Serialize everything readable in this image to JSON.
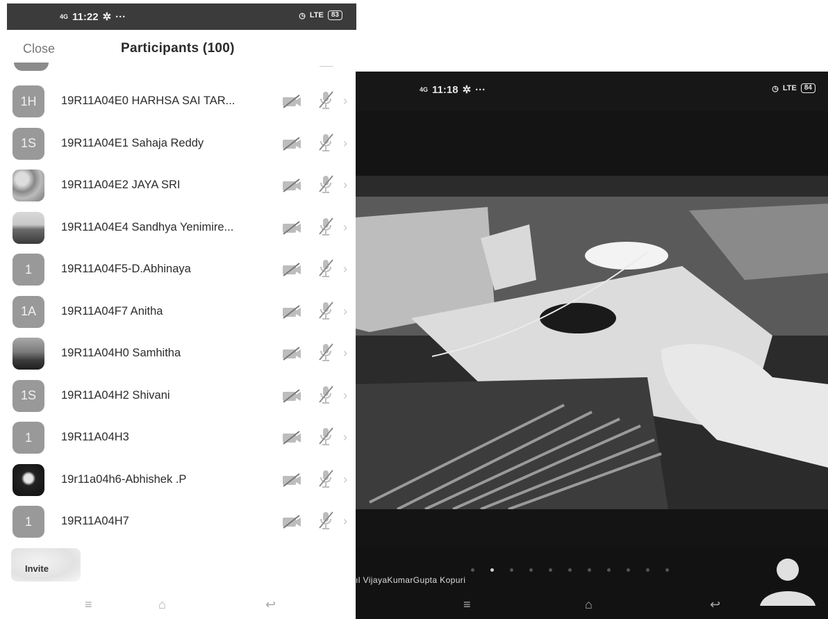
{
  "left_status": {
    "network": "4G",
    "time": "11:22",
    "battery": "83",
    "extras": "···"
  },
  "right_status": {
    "network": "4G",
    "time": "11:18",
    "battery": "84",
    "extras": "···"
  },
  "header": {
    "close_label": "Close",
    "title": "Participants (100)"
  },
  "participants": [
    {
      "initials": "1H",
      "name": "19R11A04E0 HARHSA SAI TAR...",
      "avatar": "initials"
    },
    {
      "initials": "1S",
      "name": "19R11A04E1 Sahaja Reddy",
      "avatar": "initials"
    },
    {
      "initials": "",
      "name": "19R11A04E2 JAYA SRI",
      "avatar": "photo"
    },
    {
      "initials": "",
      "name": "19R11A04E4 Sandhya Yenimire...",
      "avatar": "photo"
    },
    {
      "initials": "1",
      "name": "19R11A04F5-D.Abhinaya",
      "avatar": "initials"
    },
    {
      "initials": "1A",
      "name": "19R11A04F7 Anitha",
      "avatar": "initials"
    },
    {
      "initials": "",
      "name": "19R11A04H0 Samhitha",
      "avatar": "photo"
    },
    {
      "initials": "1S",
      "name": "19R11A04H2 Shivani",
      "avatar": "initials"
    },
    {
      "initials": "1",
      "name": "19R11A04H3",
      "avatar": "initials"
    },
    {
      "initials": "",
      "name": "19r11a04h6-Abhishek .P",
      "avatar": "photo"
    },
    {
      "initials": "1",
      "name": "19R11A04H7",
      "avatar": "initials"
    }
  ],
  "participant_icons": {
    "camera": "camera-off-icon",
    "mic": "mic-muted-icon",
    "chevron": "chevron-right-icon"
  },
  "invite_label": "Invite",
  "video": {
    "speaker_name": "VijayaKumarGupta Kopuri",
    "page_count": 11,
    "active_page": 2
  },
  "nav": {
    "menu": "≡",
    "home": "⌂",
    "back": "↩"
  },
  "colors": {
    "status_bar_left": "#3b3b3b",
    "status_bar_right": "#171717",
    "avatar_gray": "#999999"
  }
}
